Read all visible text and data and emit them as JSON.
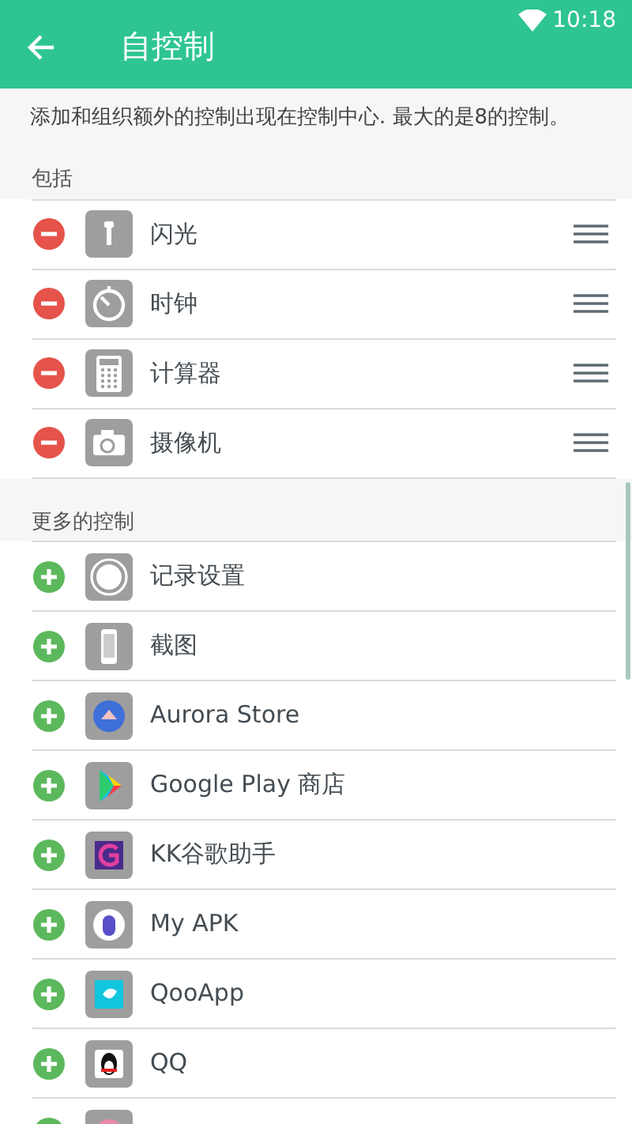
{
  "status_bar": {
    "time": "10:18"
  },
  "app_bar": {
    "title": "自控制"
  },
  "description": "添加和组织额外的控制出现在控制中心. 最大的是8的控制。",
  "sections": [
    {
      "kind": "included",
      "title": "包括",
      "items": [
        {
          "label": "闪光"
        },
        {
          "label": "时钟"
        },
        {
          "label": "计算器"
        },
        {
          "label": "摄像机"
        }
      ]
    },
    {
      "kind": "available",
      "title": "更多的控制",
      "items": [
        {
          "label": "记录设置"
        },
        {
          "label": "截图"
        },
        {
          "label": "Aurora Store"
        },
        {
          "label": "Google Play 商店"
        },
        {
          "label": "KK谷歌助手"
        },
        {
          "label": "My APK"
        },
        {
          "label": "QooApp"
        },
        {
          "label": "QQ"
        }
      ],
      "partial_row_below": true
    }
  ]
}
